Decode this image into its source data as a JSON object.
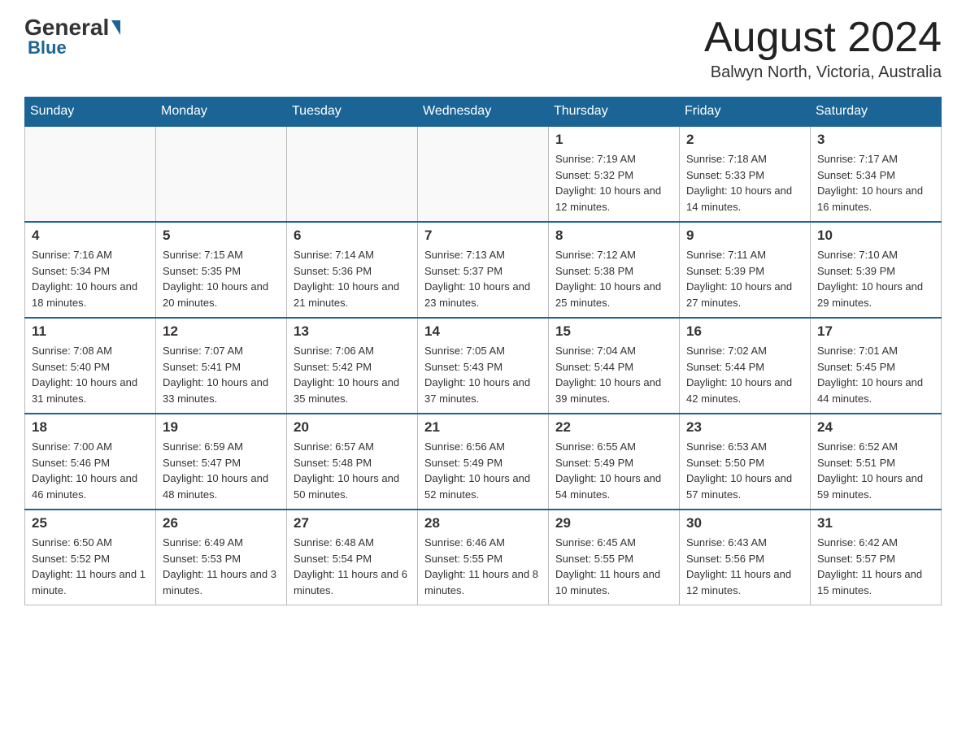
{
  "header": {
    "logo": {
      "general": "General",
      "blue": "Blue"
    },
    "title": "August 2024",
    "location": "Balwyn North, Victoria, Australia"
  },
  "weekdays": [
    "Sunday",
    "Monday",
    "Tuesday",
    "Wednesday",
    "Thursday",
    "Friday",
    "Saturday"
  ],
  "weeks": [
    [
      {
        "day": "",
        "info": ""
      },
      {
        "day": "",
        "info": ""
      },
      {
        "day": "",
        "info": ""
      },
      {
        "day": "",
        "info": ""
      },
      {
        "day": "1",
        "info": "Sunrise: 7:19 AM\nSunset: 5:32 PM\nDaylight: 10 hours and 12 minutes."
      },
      {
        "day": "2",
        "info": "Sunrise: 7:18 AM\nSunset: 5:33 PM\nDaylight: 10 hours and 14 minutes."
      },
      {
        "day": "3",
        "info": "Sunrise: 7:17 AM\nSunset: 5:34 PM\nDaylight: 10 hours and 16 minutes."
      }
    ],
    [
      {
        "day": "4",
        "info": "Sunrise: 7:16 AM\nSunset: 5:34 PM\nDaylight: 10 hours and 18 minutes."
      },
      {
        "day": "5",
        "info": "Sunrise: 7:15 AM\nSunset: 5:35 PM\nDaylight: 10 hours and 20 minutes."
      },
      {
        "day": "6",
        "info": "Sunrise: 7:14 AM\nSunset: 5:36 PM\nDaylight: 10 hours and 21 minutes."
      },
      {
        "day": "7",
        "info": "Sunrise: 7:13 AM\nSunset: 5:37 PM\nDaylight: 10 hours and 23 minutes."
      },
      {
        "day": "8",
        "info": "Sunrise: 7:12 AM\nSunset: 5:38 PM\nDaylight: 10 hours and 25 minutes."
      },
      {
        "day": "9",
        "info": "Sunrise: 7:11 AM\nSunset: 5:39 PM\nDaylight: 10 hours and 27 minutes."
      },
      {
        "day": "10",
        "info": "Sunrise: 7:10 AM\nSunset: 5:39 PM\nDaylight: 10 hours and 29 minutes."
      }
    ],
    [
      {
        "day": "11",
        "info": "Sunrise: 7:08 AM\nSunset: 5:40 PM\nDaylight: 10 hours and 31 minutes."
      },
      {
        "day": "12",
        "info": "Sunrise: 7:07 AM\nSunset: 5:41 PM\nDaylight: 10 hours and 33 minutes."
      },
      {
        "day": "13",
        "info": "Sunrise: 7:06 AM\nSunset: 5:42 PM\nDaylight: 10 hours and 35 minutes."
      },
      {
        "day": "14",
        "info": "Sunrise: 7:05 AM\nSunset: 5:43 PM\nDaylight: 10 hours and 37 minutes."
      },
      {
        "day": "15",
        "info": "Sunrise: 7:04 AM\nSunset: 5:44 PM\nDaylight: 10 hours and 39 minutes."
      },
      {
        "day": "16",
        "info": "Sunrise: 7:02 AM\nSunset: 5:44 PM\nDaylight: 10 hours and 42 minutes."
      },
      {
        "day": "17",
        "info": "Sunrise: 7:01 AM\nSunset: 5:45 PM\nDaylight: 10 hours and 44 minutes."
      }
    ],
    [
      {
        "day": "18",
        "info": "Sunrise: 7:00 AM\nSunset: 5:46 PM\nDaylight: 10 hours and 46 minutes."
      },
      {
        "day": "19",
        "info": "Sunrise: 6:59 AM\nSunset: 5:47 PM\nDaylight: 10 hours and 48 minutes."
      },
      {
        "day": "20",
        "info": "Sunrise: 6:57 AM\nSunset: 5:48 PM\nDaylight: 10 hours and 50 minutes."
      },
      {
        "day": "21",
        "info": "Sunrise: 6:56 AM\nSunset: 5:49 PM\nDaylight: 10 hours and 52 minutes."
      },
      {
        "day": "22",
        "info": "Sunrise: 6:55 AM\nSunset: 5:49 PM\nDaylight: 10 hours and 54 minutes."
      },
      {
        "day": "23",
        "info": "Sunrise: 6:53 AM\nSunset: 5:50 PM\nDaylight: 10 hours and 57 minutes."
      },
      {
        "day": "24",
        "info": "Sunrise: 6:52 AM\nSunset: 5:51 PM\nDaylight: 10 hours and 59 minutes."
      }
    ],
    [
      {
        "day": "25",
        "info": "Sunrise: 6:50 AM\nSunset: 5:52 PM\nDaylight: 11 hours and 1 minute."
      },
      {
        "day": "26",
        "info": "Sunrise: 6:49 AM\nSunset: 5:53 PM\nDaylight: 11 hours and 3 minutes."
      },
      {
        "day": "27",
        "info": "Sunrise: 6:48 AM\nSunset: 5:54 PM\nDaylight: 11 hours and 6 minutes."
      },
      {
        "day": "28",
        "info": "Sunrise: 6:46 AM\nSunset: 5:55 PM\nDaylight: 11 hours and 8 minutes."
      },
      {
        "day": "29",
        "info": "Sunrise: 6:45 AM\nSunset: 5:55 PM\nDaylight: 11 hours and 10 minutes."
      },
      {
        "day": "30",
        "info": "Sunrise: 6:43 AM\nSunset: 5:56 PM\nDaylight: 11 hours and 12 minutes."
      },
      {
        "day": "31",
        "info": "Sunrise: 6:42 AM\nSunset: 5:57 PM\nDaylight: 11 hours and 15 minutes."
      }
    ]
  ]
}
